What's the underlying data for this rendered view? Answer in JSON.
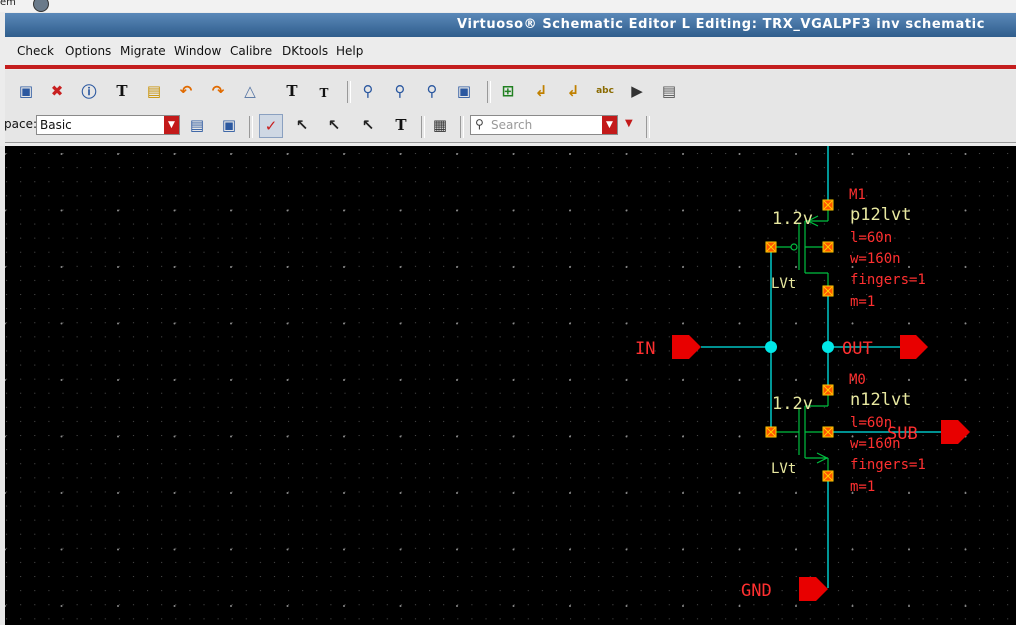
{
  "top_strip": {
    "partial_text": "em"
  },
  "window": {
    "title": "Virtuoso® Schematic Editor L Editing: TRX_VGALPF3 inv schematic"
  },
  "menu": {
    "items": [
      "Check",
      "Options",
      "Migrate",
      "Window",
      "Calibre",
      "DKtools",
      "Help"
    ]
  },
  "toolbar": {
    "icons": [
      "fit-icon",
      "delete-icon",
      "info-icon",
      "text-edit-icon",
      "note-icon",
      "undo-icon",
      "redo-icon",
      "stretch-icon",
      "text-bigger-icon",
      "text-smaller-icon",
      "zoom-in-icon",
      "zoom-out-icon",
      "zoom-fit-icon",
      "zoom-area-icon",
      "add-instance-icon",
      "add-wire-icon",
      "add-wire-narrow-icon",
      "add-label-icon",
      "add-pin-icon",
      "property-icon"
    ]
  },
  "workspace": {
    "label": "pace:",
    "value": "Basic",
    "search_placeholder": "Search"
  },
  "colors": {
    "canvas": "#000000",
    "wire": "#00ffff",
    "device": "#00c040",
    "pin_red": "#e80000",
    "label_red": "#ff3030",
    "param_yellow": "#e8e8a0"
  },
  "schematic": {
    "pins": {
      "in": "IN",
      "out": "OUT",
      "gnd": "GND",
      "sub": "SUB"
    },
    "pmos": {
      "inst": "M1",
      "cell": "p12lvt",
      "l": "l=60n",
      "w": "w=160n",
      "fingers": "fingers=1",
      "m": "m=1",
      "voltage": "1.2v",
      "vt": "LVt"
    },
    "nmos": {
      "inst": "M0",
      "cell": "n12lvt",
      "l": "l=60n",
      "w": "w=160n",
      "fingers": "fingers=1",
      "m": "m=1",
      "voltage": "1.2v",
      "vt": "LVt"
    }
  }
}
